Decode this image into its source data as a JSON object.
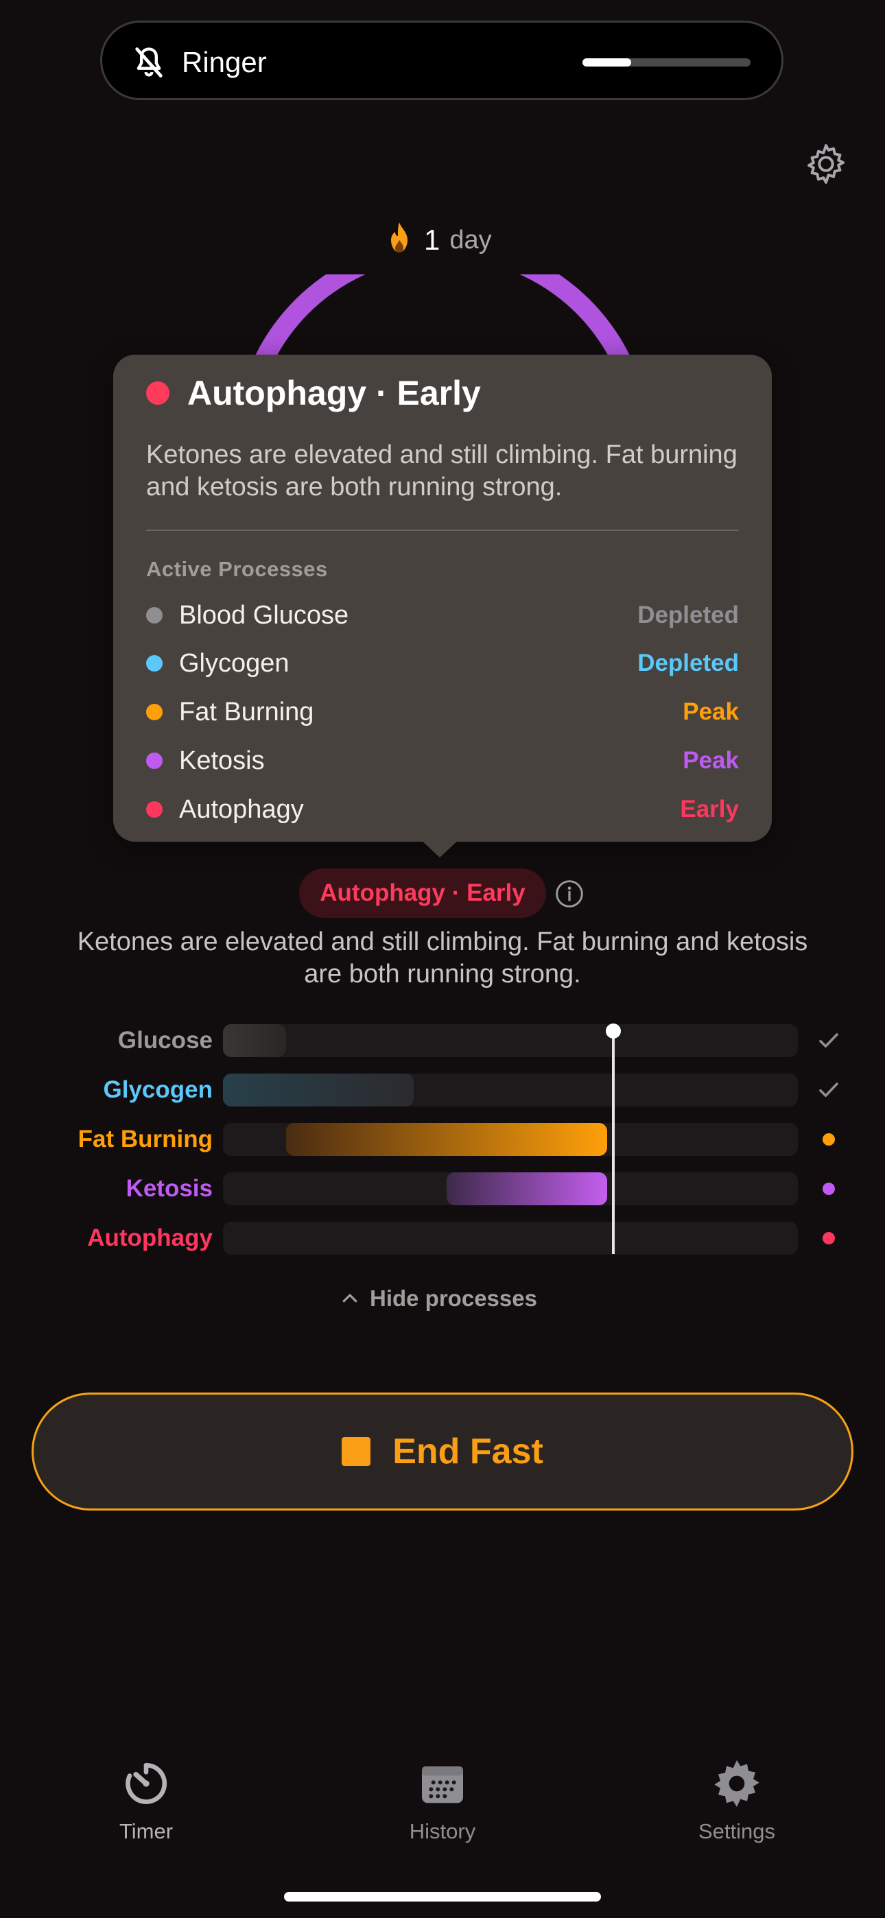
{
  "colors": {
    "glucose": "#8e8e93",
    "glycogen": "#5ac8fa",
    "fat_burning": "#ff9f0a",
    "ketosis": "#bf5af2",
    "autophagy": "#ff375f",
    "accent": "#f99e15"
  },
  "ringer": {
    "label": "Ringer",
    "icon": "bell-slash-icon",
    "volume_fraction": 0.29
  },
  "streak": {
    "icon": "flame-icon",
    "value": "1",
    "unit": "day"
  },
  "popover": {
    "title": "Autophagy · Early",
    "description": "Ketones are elevated and still climbing. Fat burning and ketosis are both running strong.",
    "section_label": "Active Processes",
    "processes": [
      {
        "name": "Blood Glucose",
        "status": "Depleted",
        "color": "#8e8e93"
      },
      {
        "name": "Glycogen",
        "status": "Depleted",
        "color": "#5ac8fa"
      },
      {
        "name": "Fat Burning",
        "status": "Peak",
        "color": "#ff9f0a"
      },
      {
        "name": "Ketosis",
        "status": "Peak",
        "color": "#bf5af2"
      },
      {
        "name": "Autophagy",
        "status": "Early",
        "color": "#ff375f"
      }
    ]
  },
  "stage": {
    "chip_label": "Autophagy · Early",
    "description": "Ketones are elevated and still climbing. Fat burning and ketosis are both running strong."
  },
  "process_bars": [
    {
      "label": "Glucose",
      "color": "#8e8e93",
      "end_marker": "checkmark-icon"
    },
    {
      "label": "Glycogen",
      "color": "#5ac8fa",
      "end_marker": "checkmark-icon"
    },
    {
      "label": "Fat Burning",
      "color": "#ff9f0a",
      "end_marker": "dot"
    },
    {
      "label": "Ketosis",
      "color": "#bf5af2",
      "end_marker": "dot"
    },
    {
      "label": "Autophagy",
      "color": "#ff375f",
      "end_marker": "dot"
    }
  ],
  "toggle": {
    "label": "Hide processes",
    "icon": "chevron-up-icon"
  },
  "end_button": {
    "label": "End Fast",
    "icon": "stop-icon"
  },
  "tabs": [
    {
      "label": "Timer",
      "icon": "timer-icon",
      "active": true
    },
    {
      "label": "History",
      "icon": "calendar-icon",
      "active": false
    },
    {
      "label": "Settings",
      "icon": "gear-icon",
      "active": false
    }
  ]
}
